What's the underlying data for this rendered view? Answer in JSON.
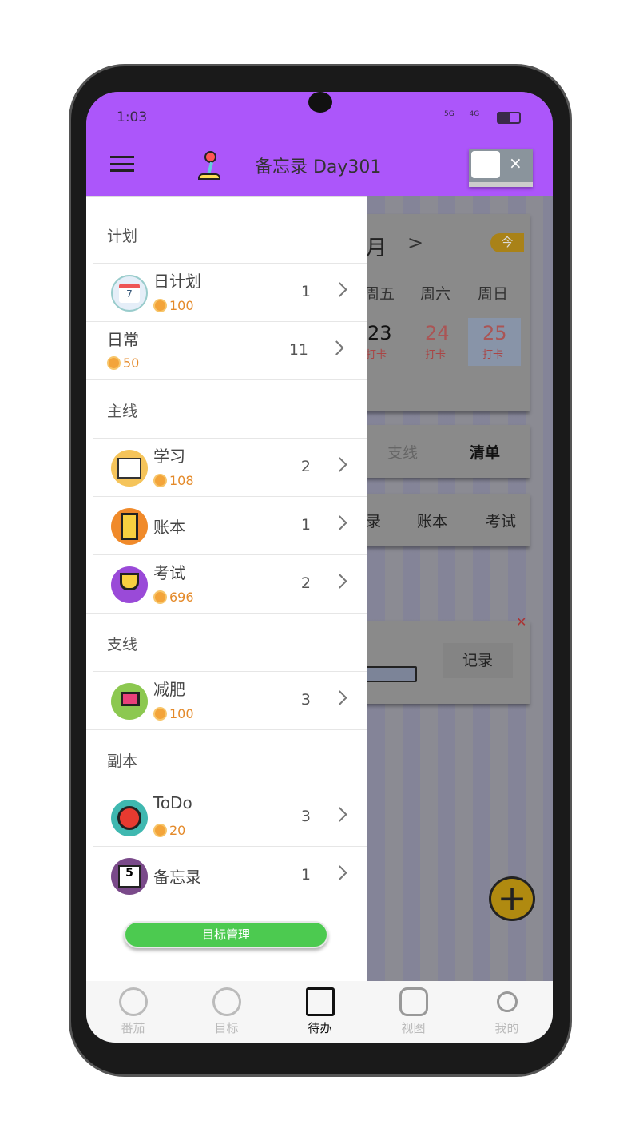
{
  "status_bar": {
    "time": "1:03",
    "network": "5G 4G"
  },
  "header": {
    "title": "备忘录 Day301",
    "menu_icon": "hamburger-icon",
    "logo_icon": "joystick-icon"
  },
  "background": {
    "calendar": {
      "month_suffix": "月",
      "today": "今",
      "weekdays": [
        "周五",
        "周六",
        "周日"
      ],
      "days": [
        {
          "num": "23",
          "label": "打卡"
        },
        {
          "num": "24",
          "label": "打卡"
        },
        {
          "num": "25",
          "label": "打卡"
        }
      ]
    },
    "tabs": [
      "支线",
      "清单"
    ],
    "sub_tabs": [
      "录",
      "账本",
      "考试"
    ],
    "record_button": "记录"
  },
  "drawer": {
    "sections": [
      {
        "title": "计划",
        "items": [
          {
            "name": "日计划",
            "coins": "100",
            "count": "1",
            "icon": "calendar-icon"
          },
          {
            "name": "日常",
            "coins": "50",
            "count": "11"
          }
        ]
      },
      {
        "title": "主线",
        "items": [
          {
            "name": "学习",
            "coins": "108",
            "count": "2",
            "icon": "book-icon"
          },
          {
            "name": "账本",
            "count": "1",
            "icon": "ledger-icon"
          },
          {
            "name": "考试",
            "coins": "696",
            "count": "2",
            "icon": "trophy-icon"
          }
        ]
      },
      {
        "title": "支线",
        "items": [
          {
            "name": "减肥",
            "coins": "100",
            "count": "3",
            "icon": "flag-icon"
          }
        ]
      },
      {
        "title": "副本",
        "items": [
          {
            "name": "ToDo",
            "coins": "20",
            "count": "3",
            "icon": "tomato-icon"
          },
          {
            "name": "备忘录",
            "count": "1",
            "icon": "calendar-5-icon"
          }
        ]
      }
    ],
    "manage_button": "目标管理"
  },
  "bottom_nav": [
    {
      "label": "番茄"
    },
    {
      "label": "目标"
    },
    {
      "label": "待办",
      "active": true
    },
    {
      "label": "视图"
    },
    {
      "label": "我的"
    }
  ],
  "colors": {
    "header": "#ac56fa",
    "button": "#4cca50",
    "coin": "#e48a2a"
  }
}
